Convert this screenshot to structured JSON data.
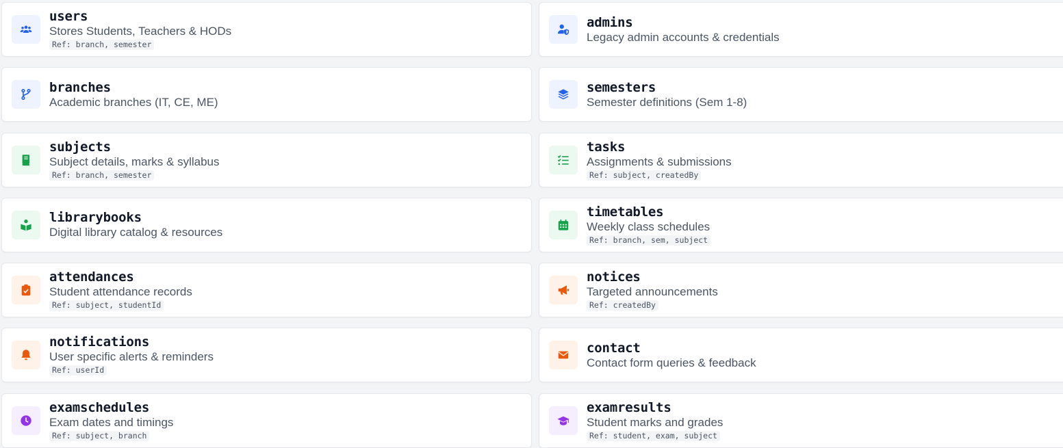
{
  "collections": [
    {
      "name": "users",
      "description": "Stores Students, Teachers & HODs",
      "ref": "Ref: branch, semester",
      "icon": "users-icon",
      "color": "#2563eb"
    },
    {
      "name": "admins",
      "description": "Legacy admin accounts & credentials",
      "ref": "",
      "icon": "user-shield-icon",
      "color": "#2563eb"
    },
    {
      "name": "branches",
      "description": "Academic branches (IT, CE, ME)",
      "ref": "",
      "icon": "code-branch-icon",
      "color": "#2563eb"
    },
    {
      "name": "semesters",
      "description": "Semester definitions (Sem 1-8)",
      "ref": "",
      "icon": "layers-icon",
      "color": "#2563eb"
    },
    {
      "name": "subjects",
      "description": "Subject details, marks & syllabus",
      "ref": "Ref: branch, semester",
      "icon": "book-icon",
      "color": "#16a34a"
    },
    {
      "name": "tasks",
      "description": "Assignments & submissions",
      "ref": "Ref: subject, createdBy",
      "icon": "list-check-icon",
      "color": "#16a34a"
    },
    {
      "name": "librarybooks",
      "description": "Digital library catalog & resources",
      "ref": "",
      "icon": "book-reader-icon",
      "color": "#16a34a"
    },
    {
      "name": "timetables",
      "description": "Weekly class schedules",
      "ref": "Ref: branch, sem, subject",
      "icon": "calendar-icon",
      "color": "#16a34a"
    },
    {
      "name": "attendances",
      "description": "Student attendance records",
      "ref": "Ref: subject, studentId",
      "icon": "clipboard-check-icon",
      "color": "#ea580c"
    },
    {
      "name": "notices",
      "description": "Targeted announcements",
      "ref": "Ref: createdBy",
      "icon": "megaphone-icon",
      "color": "#ea580c"
    },
    {
      "name": "notifications",
      "description": "User specific alerts & reminders",
      "ref": "Ref: userId",
      "icon": "bell-icon",
      "color": "#ea580c"
    },
    {
      "name": "contact",
      "description": "Contact form queries & feedback",
      "ref": "",
      "icon": "envelope-icon",
      "color": "#ea580c"
    },
    {
      "name": "examschedules",
      "description": "Exam dates and timings",
      "ref": "Ref: subject, branch",
      "icon": "clock-icon",
      "color": "#9333ea"
    },
    {
      "name": "examresults",
      "description": "Student marks and grades",
      "ref": "Ref: student, exam, subject",
      "icon": "graduation-cap-icon",
      "color": "#9333ea"
    }
  ]
}
